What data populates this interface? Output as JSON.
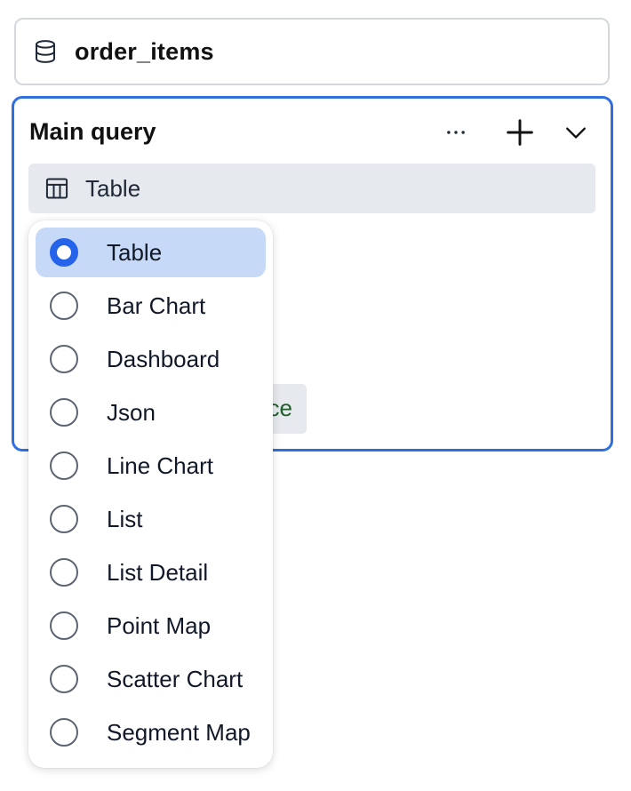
{
  "source": {
    "name": "order_items",
    "icon": "database-icon"
  },
  "query": {
    "title": "Main query",
    "actions": [
      {
        "name": "more-options-icon"
      },
      {
        "name": "add-icon"
      },
      {
        "name": "chevron-down-icon"
      }
    ],
    "view_selector": {
      "icon": "table-icon",
      "label": "Table"
    },
    "partial_chip_text": "ce"
  },
  "dropdown": {
    "selected": "Table",
    "options": [
      {
        "label": "Table",
        "selected": true
      },
      {
        "label": "Bar Chart",
        "selected": false
      },
      {
        "label": "Dashboard",
        "selected": false
      },
      {
        "label": "Json",
        "selected": false
      },
      {
        "label": "Line Chart",
        "selected": false
      },
      {
        "label": "List",
        "selected": false
      },
      {
        "label": "List Detail",
        "selected": false
      },
      {
        "label": "Point Map",
        "selected": false
      },
      {
        "label": "Scatter Chart",
        "selected": false
      },
      {
        "label": "Segment Map",
        "selected": false
      }
    ]
  },
  "colors": {
    "accent": "#2f6fe0",
    "selected_bg": "#c6d9f7",
    "radio_selected": "#2563eb",
    "chip_text": "#1e5e2a"
  }
}
